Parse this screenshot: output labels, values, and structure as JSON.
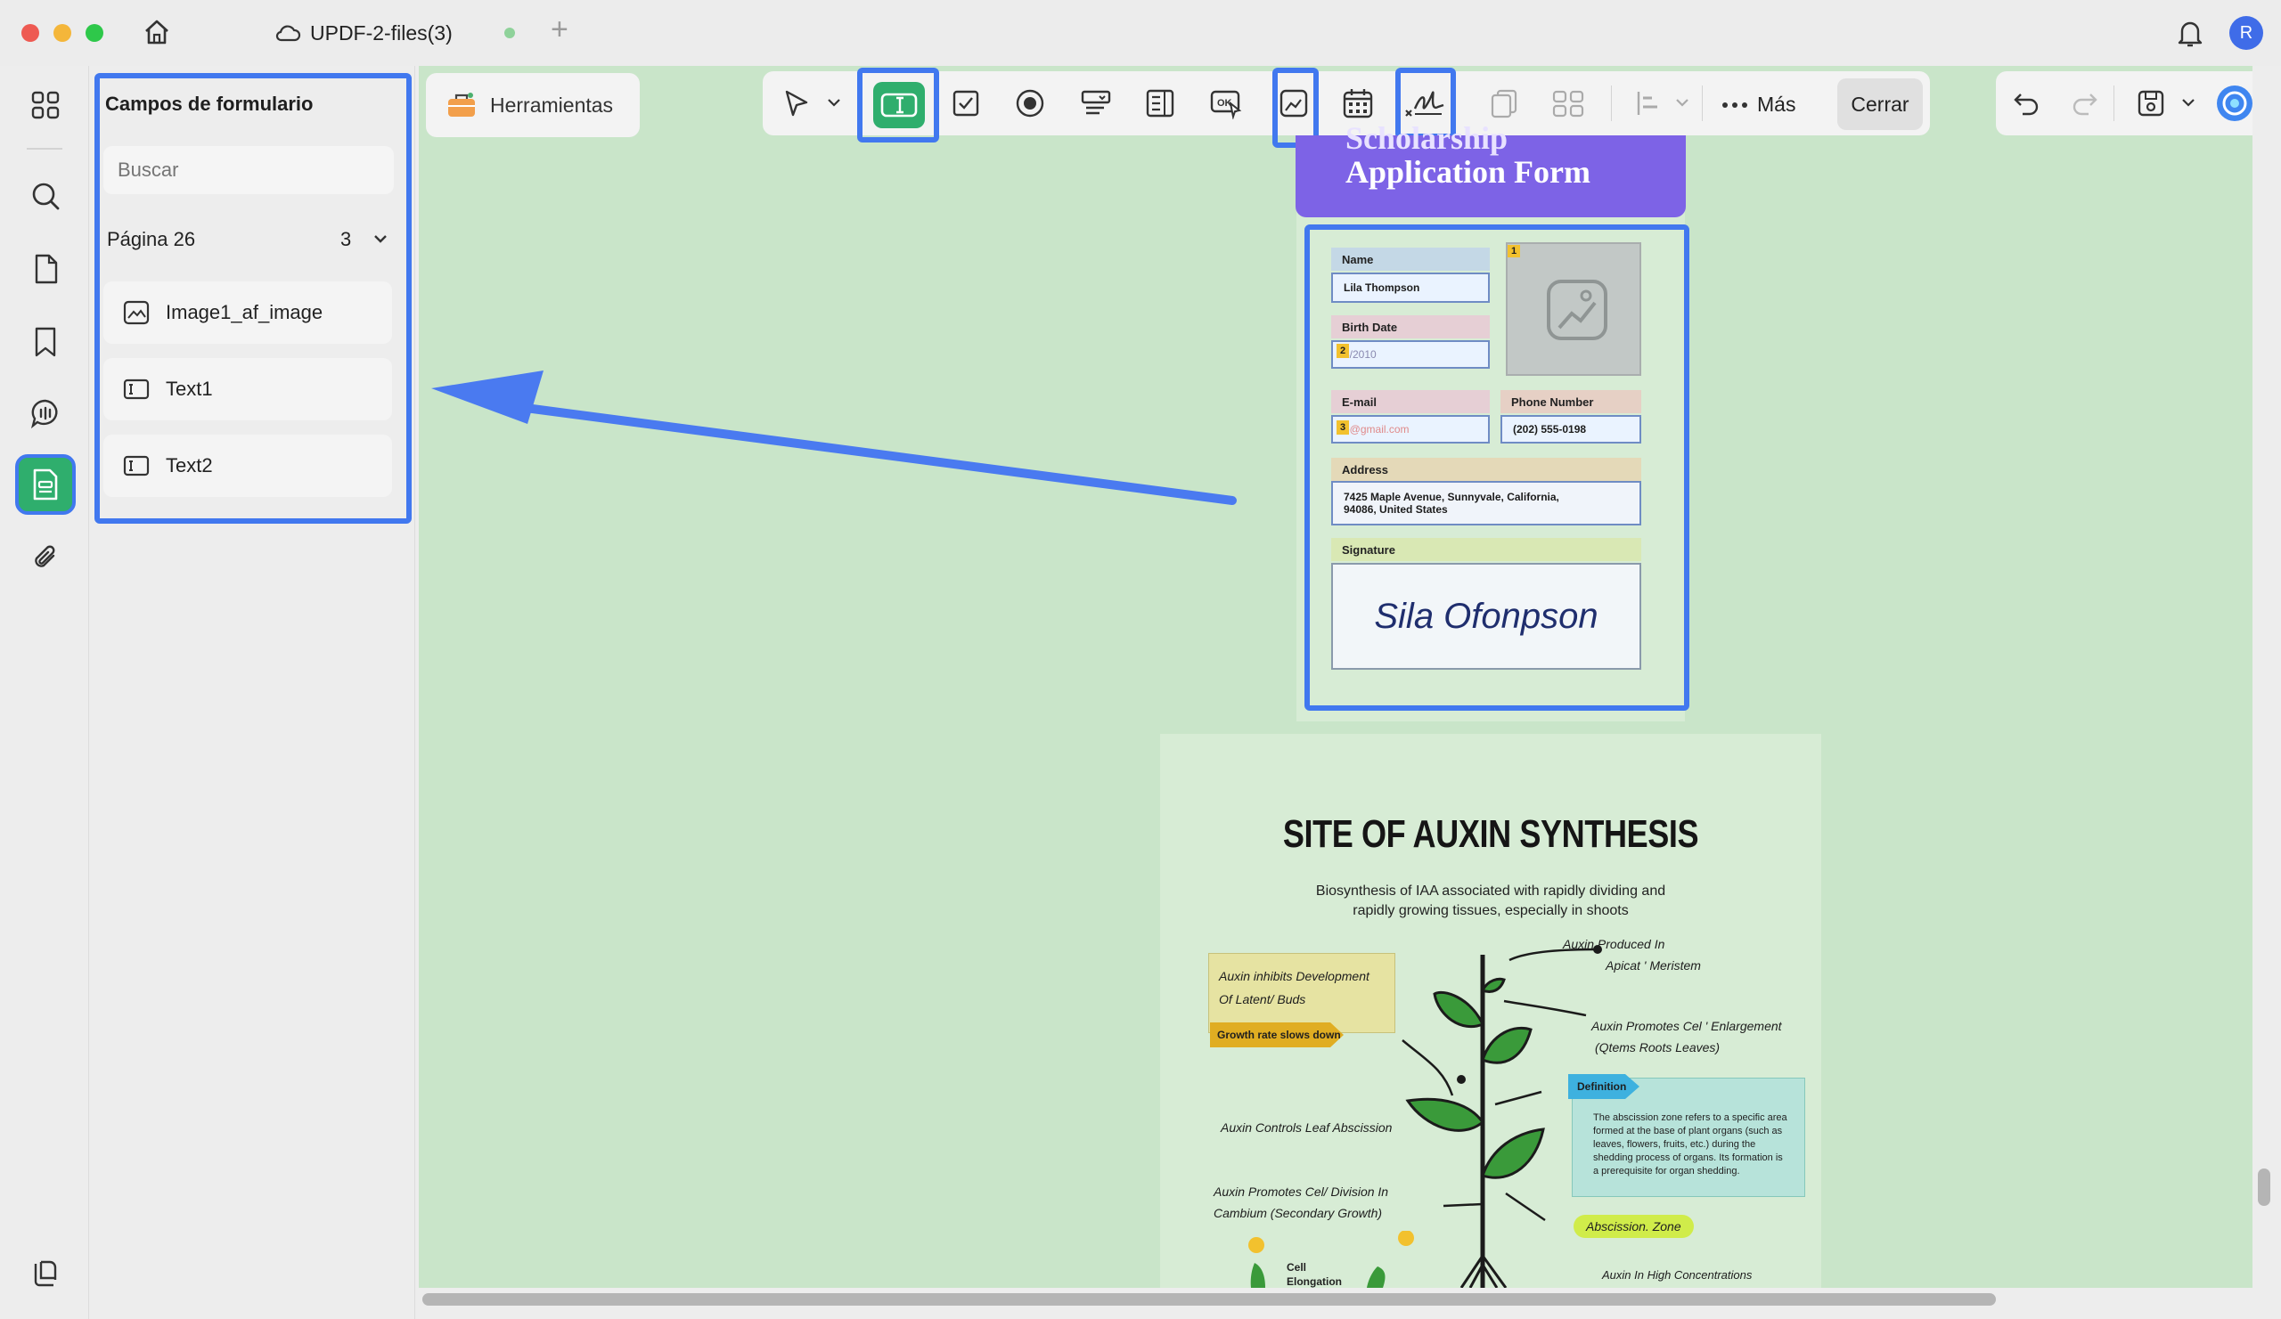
{
  "window": {
    "tab_title": "UPDF-2-files(3)",
    "new_tab_symbol": "+",
    "avatar_initial": "R"
  },
  "panel": {
    "title": "Campos de formulario",
    "search_placeholder": "Buscar",
    "page_label": "Página 26",
    "page_count": "3",
    "fields": [
      {
        "label": "Image1_af_image",
        "icon": "image-field-icon"
      },
      {
        "label": "Text1",
        "icon": "text-field-icon"
      },
      {
        "label": "Text2",
        "icon": "text-field-icon"
      }
    ]
  },
  "toolbar": {
    "tools_label": "Herramientas",
    "more_label": "Más",
    "close_label": "Cerrar"
  },
  "form": {
    "title_partial": "Scholarship",
    "title": "Application Form",
    "name_label": "Name",
    "name_value": "Lila Thompson",
    "birth_label": "Birth Date",
    "birth_value": "8/2010",
    "email_label": "E-mail",
    "email_value": "e@gmail.com",
    "phone_label": "Phone Number",
    "phone_value": "(202) 555-0198",
    "address_label": "Address",
    "address_line1": "7425 Maple Avenue, Sunnyvale, California,",
    "address_line2": "94086, United States",
    "signature_label": "Signature",
    "signature_value": "Sila Ofonpson",
    "badges": [
      "1",
      "2",
      "3"
    ]
  },
  "poster": {
    "title": "SITE OF AUXIN SYNTHESIS",
    "subtitle_line1": "Biosynthesis of IAA associated with rapidly dividing and",
    "subtitle_line2": "rapidly growing tissues, especially in shoots",
    "left_box_line1": "Auxin inhibits Development",
    "left_box_line2": "Of Latent/ Buds",
    "growth_tag": "Growth rate slows down",
    "leaf_abscission": "Auxin Controls Leaf Abscission",
    "cell_div_line1": "Auxin Promotes Cel/ Division In",
    "cell_div_line2": "Cambium (Secondary Growth)",
    "cell_line1": "Cell",
    "cell_line2": "Elongation",
    "produced_line1": "Auxin Produced In",
    "produced_line2": "Apicat ' Meristem",
    "enlarge_line1": "Auxin Promotes Cel ' Enlargement",
    "enlarge_line2": "(Qtems Roots Leaves)",
    "definition_tag": "Definition",
    "definition_lines": [
      "The abscission zone refers to a specific area",
      "formed at the base of plant organs (such as",
      "leaves, flowers, fruits, etc.) during the",
      "shedding process of organs. Its formation is",
      "a prerequisite for organ shedding."
    ],
    "zone_tag": "Abscission. Zone",
    "high_conc": "Auxin In High Concentrations"
  },
  "colors": {
    "highlight": "#4178ef",
    "accent_green": "#2fae6d",
    "canvas": "#c9e5c9",
    "form_header": "#8064e6"
  }
}
